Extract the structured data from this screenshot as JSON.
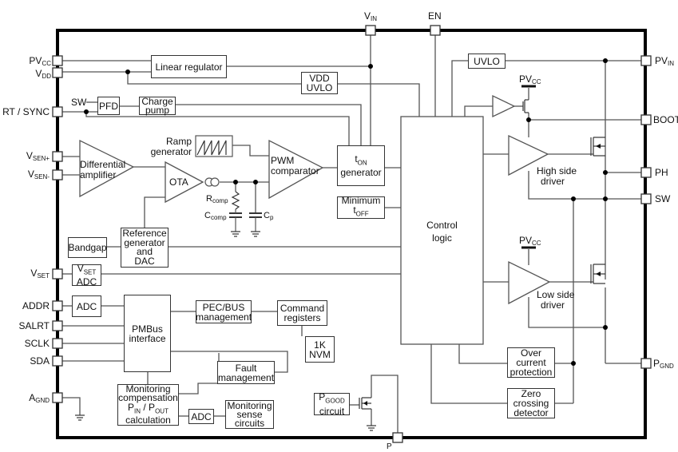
{
  "diagram": {
    "type": "block diagram",
    "pins": {
      "left": [
        {
          "id": "pvcc",
          "name": "PV",
          "sub": "CC"
        },
        {
          "id": "vdd",
          "name": "V",
          "sub": "DD"
        },
        {
          "id": "rtsync",
          "name": "RT / SYNC",
          "sub": ""
        },
        {
          "id": "vsenp",
          "name": "V",
          "sub": "SEN+"
        },
        {
          "id": "vsenm",
          "name": "V",
          "sub": "SEN-"
        },
        {
          "id": "vset",
          "name": "V",
          "sub": "SET"
        },
        {
          "id": "addr",
          "name": "ADDR",
          "sub": ""
        },
        {
          "id": "salrt",
          "name": "SALRT",
          "sub": ""
        },
        {
          "id": "sclk",
          "name": "SCLK",
          "sub": ""
        },
        {
          "id": "sda",
          "name": "SDA",
          "sub": ""
        },
        {
          "id": "agnd",
          "name": "A",
          "sub": "GND"
        }
      ],
      "top": [
        {
          "id": "vin",
          "name": "V",
          "sub": "IN"
        },
        {
          "id": "en",
          "name": "EN",
          "sub": ""
        }
      ],
      "right": [
        {
          "id": "pvin",
          "name": "PV",
          "sub": "IN"
        },
        {
          "id": "boot",
          "name": "BOOT",
          "sub": ""
        },
        {
          "id": "ph",
          "name": "PH",
          "sub": ""
        },
        {
          "id": "sw",
          "name": "SW",
          "sub": ""
        },
        {
          "id": "pgnd",
          "name": "P",
          "sub": "GND"
        }
      ],
      "bottom": [
        {
          "id": "pgood",
          "name": "P",
          "sub": ""
        }
      ]
    },
    "blocks": {
      "linear_regulator": "Linear regulator",
      "vdd_uvlo_1": "VDD",
      "vdd_uvlo_2": "UVLO",
      "uvlo": "UVLO",
      "pfd": "PFD",
      "charge_pump_1": "Charge",
      "charge_pump_2": "pump",
      "sw_input": "SW",
      "ramp_generator_1": "Ramp",
      "ramp_generator_2": "generator",
      "differential_amplifier_1": "Differential",
      "differential_amplifier_2": "amplifier",
      "ota": "OTA",
      "pwm_comparator_1": "PWM",
      "pwm_comparator_2": "comparator",
      "ton_generator_t": "t",
      "ton_generator_sub": "ON",
      "ton_generator_2": "generator",
      "min_toff_1": "Minimum",
      "min_toff_t": "t",
      "min_toff_sub": "OFF",
      "control_logic_1": "Control",
      "control_logic_2": "logic",
      "rcomp": "R",
      "rcomp_sub": "comp",
      "ccomp": "C",
      "ccomp_sub": "comp",
      "cp": "C",
      "cp_sub": "p",
      "bandgap": "Bandgap",
      "reference_1": "Reference",
      "reference_2": "generator",
      "reference_3": "and",
      "reference_4": "DAC",
      "vset_adc_v": "V",
      "vset_adc_sub": "SET",
      "vset_adc_2": "ADC",
      "addr_adc": "ADC",
      "pmbus_1": "PMBus",
      "pmbus_2": "interface",
      "pec_1": "PEC/BUS",
      "pec_2": "management",
      "command_1": "Command",
      "command_2": "registers",
      "nvm_1": "1K",
      "nvm_2": "NVM",
      "fault_1": "Fault",
      "fault_2": "management",
      "monitoring_comp_1": "Monitoring",
      "monitoring_comp_2": "compensation",
      "monitoring_comp_pin": "P",
      "monitoring_comp_pin_sub": "IN",
      "monitoring_comp_slash": " / P",
      "monitoring_comp_pout_sub": "OUT",
      "monitoring_comp_4": "calculation",
      "monitor_adc": "ADC",
      "monitoring_sense_1": "Monitoring",
      "monitoring_sense_2": "sense",
      "monitoring_sense_3": "circuits",
      "pgood_p": "P",
      "pgood_sub": "GOOD",
      "pgood_2": "circuit",
      "high_side_1": "High side",
      "high_side_2": "driver",
      "low_side_1": "Low side",
      "low_side_2": "driver",
      "pvcc_hs": "PV",
      "pvcc_hs_sub": "CC",
      "pvcc_ls": "PV",
      "pvcc_ls_sub": "CC",
      "overcurrent_1": "Over",
      "overcurrent_2": "current",
      "overcurrent_3": "protection",
      "zero_1": "Zero",
      "zero_2": "crossing",
      "zero_3": "detector"
    }
  }
}
